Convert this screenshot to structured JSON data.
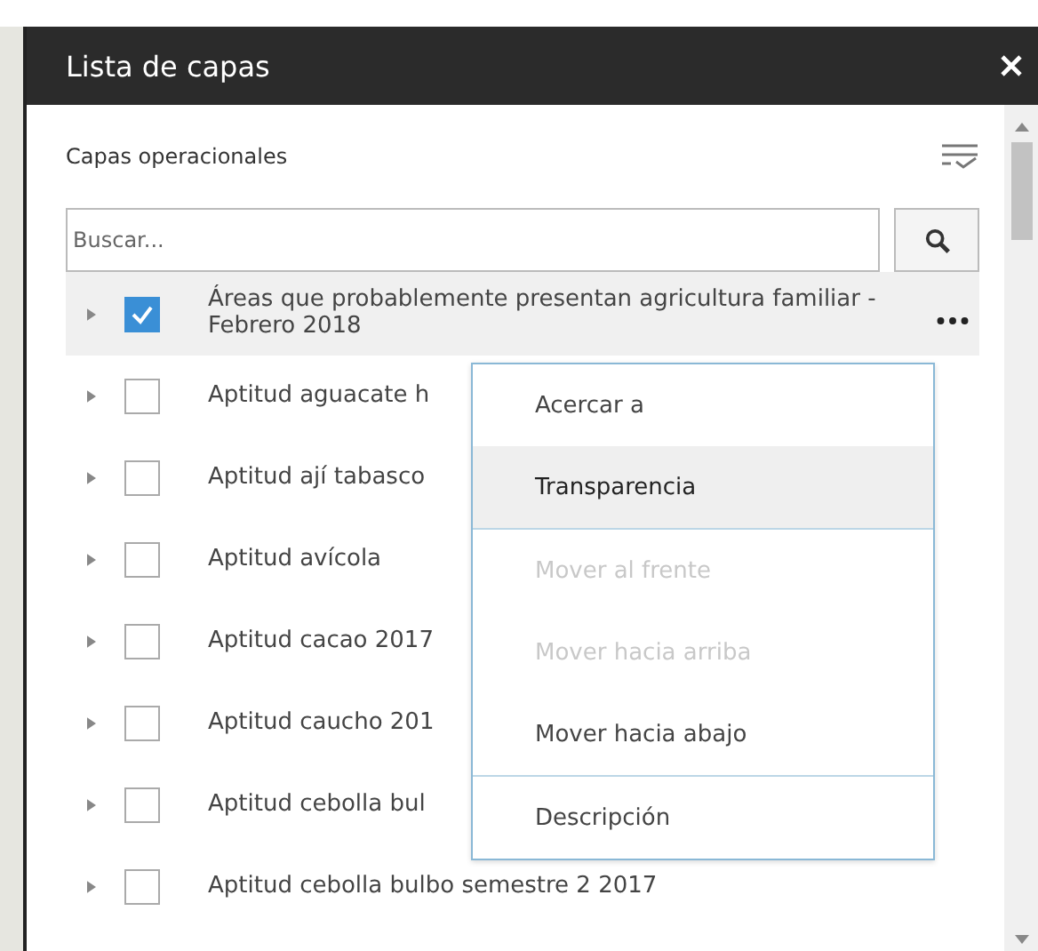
{
  "window": {
    "title": "Lista de capas"
  },
  "section": {
    "title": "Capas operacionales"
  },
  "search": {
    "placeholder": "Buscar..."
  },
  "layers": [
    {
      "label": "Áreas que probablemente presentan agricultura familiar - Febrero 2018",
      "checked": true,
      "selected": true
    },
    {
      "label": "Aptitud aguacate h",
      "checked": false,
      "selected": false
    },
    {
      "label": "Aptitud ají tabasco",
      "checked": false,
      "selected": false
    },
    {
      "label": "Aptitud avícola",
      "checked": false,
      "selected": false
    },
    {
      "label": "Aptitud cacao 2017",
      "checked": false,
      "selected": false
    },
    {
      "label": "Aptitud caucho 201",
      "checked": false,
      "selected": false
    },
    {
      "label": "Aptitud cebolla bul",
      "checked": false,
      "selected": false
    },
    {
      "label": "Aptitud cebolla bulbo semestre 2 2017",
      "checked": false,
      "selected": false
    }
  ],
  "context_menu": {
    "groups": [
      [
        {
          "label": "Acercar a",
          "selected": false,
          "disabled": false
        },
        {
          "label": "Transparencia",
          "selected": true,
          "disabled": false
        }
      ],
      [
        {
          "label": "Mover al frente",
          "selected": false,
          "disabled": true
        },
        {
          "label": "Mover hacia arriba",
          "selected": false,
          "disabled": true
        },
        {
          "label": "Mover hacia abajo",
          "selected": false,
          "disabled": false
        }
      ],
      [
        {
          "label": "Descripción",
          "selected": false,
          "disabled": false
        }
      ]
    ]
  }
}
